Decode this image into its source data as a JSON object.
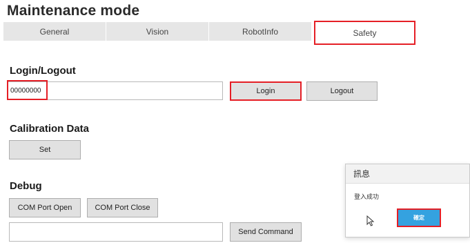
{
  "page": {
    "title": "Maintenance mode"
  },
  "tabs": [
    {
      "label": "General",
      "active": false
    },
    {
      "label": "Vision",
      "active": false
    },
    {
      "label": "RobotInfo",
      "active": false
    },
    {
      "label": "Safety",
      "active": true
    }
  ],
  "login": {
    "heading": "Login/Logout",
    "password_value": "00000000",
    "login_label": "Login",
    "logout_label": "Logout"
  },
  "calibration": {
    "heading": "Calibration Data",
    "set_label": "Set"
  },
  "debug": {
    "heading": "Debug",
    "com_open_label": "COM Port Open",
    "com_close_label": "COM Port Close",
    "command_value": "",
    "send_label": "Send Command"
  },
  "dialog": {
    "title": "訊息",
    "message": "登入成功",
    "ok_label": "確定"
  },
  "colors": {
    "highlight": "#e51e25",
    "accent": "#34a2e0",
    "tab_bg": "#e6e6e6",
    "button_bg": "#e1e1e1"
  },
  "icons": {
    "cursor": "mouse-pointer-icon"
  }
}
